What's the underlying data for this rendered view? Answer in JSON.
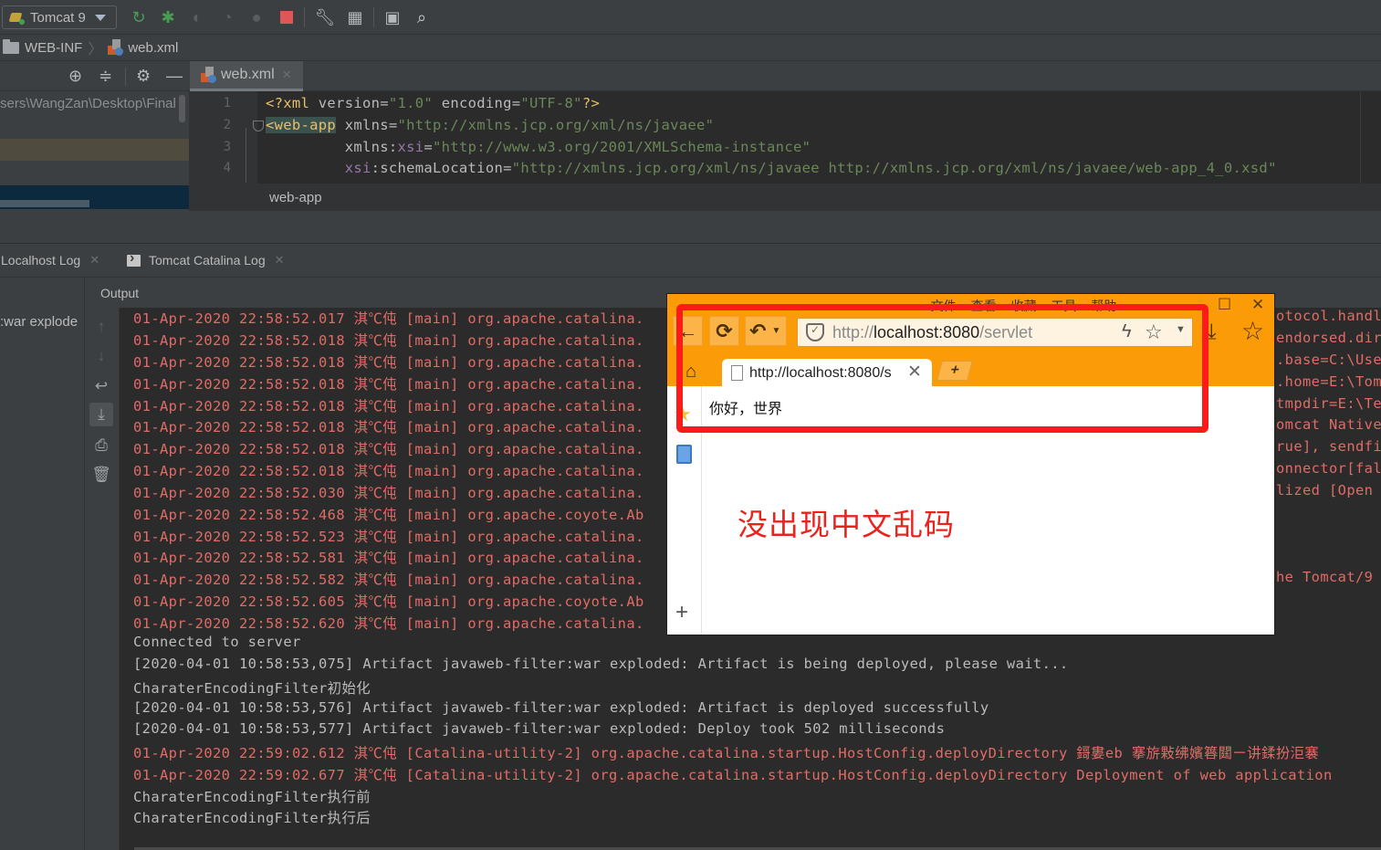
{
  "toolbar": {
    "run_config": "Tomcat 9",
    "icons": [
      "rerun-icon",
      "debug-icon",
      "run-coverage-icon",
      "profile-icon",
      "attach-icon",
      "stop-icon",
      "settings-wrench-icon",
      "project-structure-icon",
      "terminal-icon",
      "search-icon"
    ]
  },
  "breadcrumb": {
    "items": [
      "WEB-INF",
      "web.xml"
    ]
  },
  "project": {
    "path": "sers\\WangZan\\Desktop\\Final"
  },
  "editor": {
    "tab": "web.xml",
    "line_numbers": [
      "1",
      "2",
      "3",
      "4"
    ],
    "lines": {
      "l1_pi_open": "<?xml ",
      "l1_a1": "version",
      "l1_v1": "\"1.0\"",
      "l1_a2": "encoding",
      "l1_v2": "\"UTF-8\"",
      "l1_pi_close": "?>",
      "l2_tag": "<web-app",
      "l2_attr": "xmlns",
      "l2_val": "\"http://xmlns.jcp.org/xml/ns/javaee\"",
      "l3_attr": "xmlns",
      "l3_ns": "xsi",
      "l3_val": "\"http://www.w3.org/2001/XMLSchema-instance\"",
      "l4_ns": "xsi",
      "l4_attr": "schemaLocation",
      "l4_val": "\"http://xmlns.jcp.org/xml/ns/javaee http://xmlns.jcp.org/xml/ns/javaee/web-app_4_0.xsd\""
    },
    "breadcrumb": "web-app"
  },
  "services": {
    "tabs": [
      "Localhost Log",
      "Tomcat Catalina Log"
    ],
    "left_item": ":war explode",
    "output_label": "Output"
  },
  "console": {
    "lines": [
      {
        "text": "01-Apr-2020 22:58:52.017 淇℃伅 [main] org.apache.catalina.",
        "tail": "otocol.handle",
        "type": "err"
      },
      {
        "text": "01-Apr-2020 22:58:52.018 淇℃伅 [main] org.apache.catalina.",
        "tail": "endorsed.dirs",
        "type": "err"
      },
      {
        "text": "01-Apr-2020 22:58:52.018 淇℃伅 [main] org.apache.catalina.",
        "tail": ".base=C:\\Use",
        "type": "err"
      },
      {
        "text": "01-Apr-2020 22:58:52.018 淇℃伅 [main] org.apache.catalina.",
        "tail": ".home=E:\\Tom",
        "type": "err"
      },
      {
        "text": "01-Apr-2020 22:58:52.018 淇℃伅 [main] org.apache.catalina.",
        "tail": "tmpdir=E:\\Te",
        "type": "err"
      },
      {
        "text": "01-Apr-2020 22:58:52.018 淇℃伅 [main] org.apache.catalina.",
        "tail": "omcat Native",
        "type": "err"
      },
      {
        "text": "01-Apr-2020 22:58:52.018 淇℃伅 [main] org.apache.catalina.",
        "tail": "rue], sendfil",
        "type": "err"
      },
      {
        "text": "01-Apr-2020 22:58:52.018 淇℃伅 [main] org.apache.catalina.",
        "tail": "onnector[fal",
        "type": "err"
      },
      {
        "text": "01-Apr-2020 22:58:52.030 淇℃伅 [main] org.apache.catalina.",
        "tail": "lized [Open",
        "type": "err"
      },
      {
        "text": "01-Apr-2020 22:58:52.468 淇℃伅 [main] org.apache.coyote.Ab",
        "tail": "",
        "type": "err"
      },
      {
        "text": "01-Apr-2020 22:58:52.523 淇℃伅 [main] org.apache.catalina.",
        "tail": "",
        "type": "err"
      },
      {
        "text": "01-Apr-2020 22:58:52.581 淇℃伅 [main] org.apache.catalina.",
        "tail": "",
        "type": "err"
      },
      {
        "text": "01-Apr-2020 22:58:52.582 淇℃伅 [main] org.apache.catalina.",
        "tail": "he Tomcat/9",
        "type": "err"
      },
      {
        "text": "01-Apr-2020 22:58:52.605 淇℃伅 [main] org.apache.coyote.Ab",
        "tail": "",
        "type": "err"
      },
      {
        "text": "01-Apr-2020 22:58:52.620 淇℃伅 [main] org.apache.catalina.",
        "tail": "",
        "type": "err"
      },
      {
        "text": "Connected to server",
        "tail": "",
        "type": "norm"
      },
      {
        "text": "[2020-04-01 10:58:53,075] Artifact javaweb-filter:war exploded: Artifact is being deployed, please wait...",
        "tail": "",
        "type": "norm"
      },
      {
        "text": "CharaterEncodingFilter初始化",
        "tail": "",
        "type": "norm"
      },
      {
        "text": "[2020-04-01 10:58:53,576] Artifact javaweb-filter:war exploded: Artifact is deployed successfully",
        "tail": "",
        "type": "norm"
      },
      {
        "text": "[2020-04-01 10:58:53,577] Artifact javaweb-filter:war exploded: Deploy took 502 milliseconds",
        "tail": "",
        "type": "norm"
      },
      {
        "text": "01-Apr-2020 22:59:02.612 淇℃伅 [Catalina-utility-2] org.apache.catalina.startup.HostConfig.deployDirectory 鎶婁eb 搴旂敤绋嬪簭閮ㄧ讲鍒扮洰褰",
        "tail": "",
        "type": "err"
      },
      {
        "text": "01-Apr-2020 22:59:02.677 淇℃伅 [Catalina-utility-2] org.apache.catalina.startup.HostConfig.deployDirectory Deployment of web application",
        "tail": "",
        "type": "err"
      },
      {
        "text": "CharaterEncodingFilter执行前",
        "tail": "",
        "type": "norm"
      },
      {
        "text": "CharaterEncodingFilter执行后",
        "tail": "",
        "type": "norm"
      }
    ]
  },
  "browser": {
    "menu": "» 文件 查看 收藏 工具 帮助",
    "url_prefix": "http://",
    "url_host": "localhost:8080",
    "url_path": "/servlet",
    "tab_title": "http://localhost:8080/s",
    "page_text": "你好，世界"
  },
  "annotation": {
    "text": "没出现中文乱码",
    "color": "#e8241f"
  },
  "colors": {
    "browser_accent": "#fb9b07",
    "highlight_box": "#ff1a1a",
    "log_error": "#e06c65"
  }
}
